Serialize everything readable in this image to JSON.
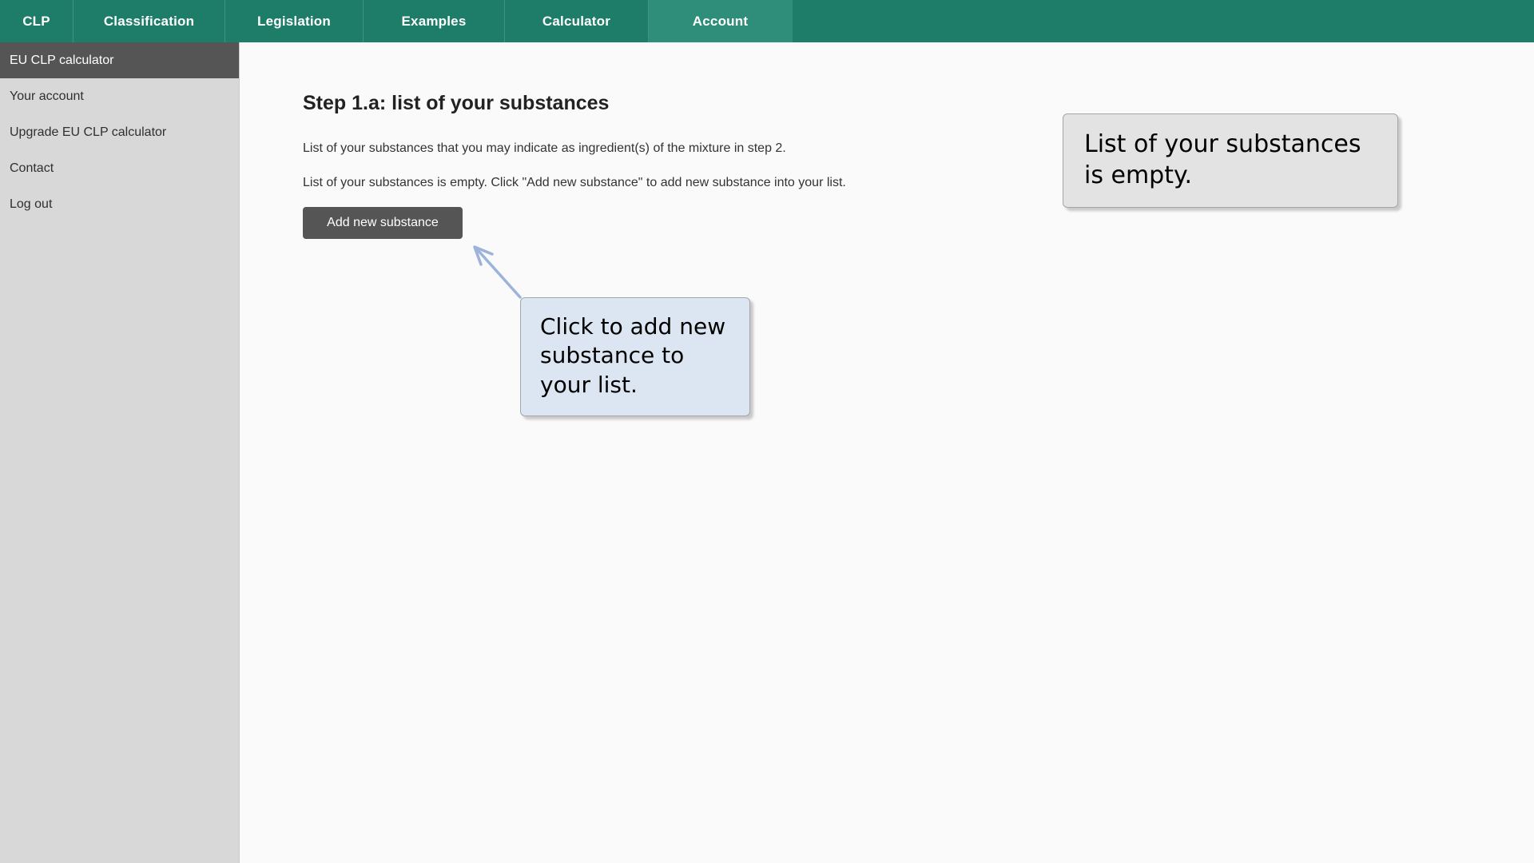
{
  "topnav": {
    "background_color": "#1d7d68",
    "active_color": "#2e8e79",
    "tabs": [
      {
        "label": "CLP",
        "active": false
      },
      {
        "label": "Classification",
        "active": false
      },
      {
        "label": "Legislation",
        "active": false
      },
      {
        "label": "Examples",
        "active": false
      },
      {
        "label": "Calculator",
        "active": false
      },
      {
        "label": "Account",
        "active": true
      }
    ]
  },
  "sidebar": {
    "background_color": "#d8d8d8",
    "active_color": "#555555",
    "items": [
      {
        "label": "EU CLP calculator",
        "active": true
      },
      {
        "label": "Your account",
        "active": false
      },
      {
        "label": "Upgrade EU CLP calculator",
        "active": false
      },
      {
        "label": "Contact",
        "active": false
      },
      {
        "label": "Log out",
        "active": false
      }
    ]
  },
  "main": {
    "title": "Step 1.a:  list of your substances",
    "paragraph_1": "List of your substances that you may indicate as ingredient(s) of the mixture in step 2.",
    "paragraph_2": "List of your substances is empty. Click \"Add new substance\" to add new substance into your list.",
    "add_button_label": "Add new substance",
    "add_button_color": "#555555"
  },
  "callouts": [
    {
      "id": "list-empty",
      "text": "List of your substances is empty.",
      "background_color": "#e3e3e3",
      "border_color": "#a6a6a6"
    },
    {
      "id": "click-to-add",
      "text": "Click to add new substance to your list.",
      "background_color": "#dce6f2",
      "border_color": "#a6a6a6",
      "arrow_color": "#9cb3da"
    }
  ]
}
